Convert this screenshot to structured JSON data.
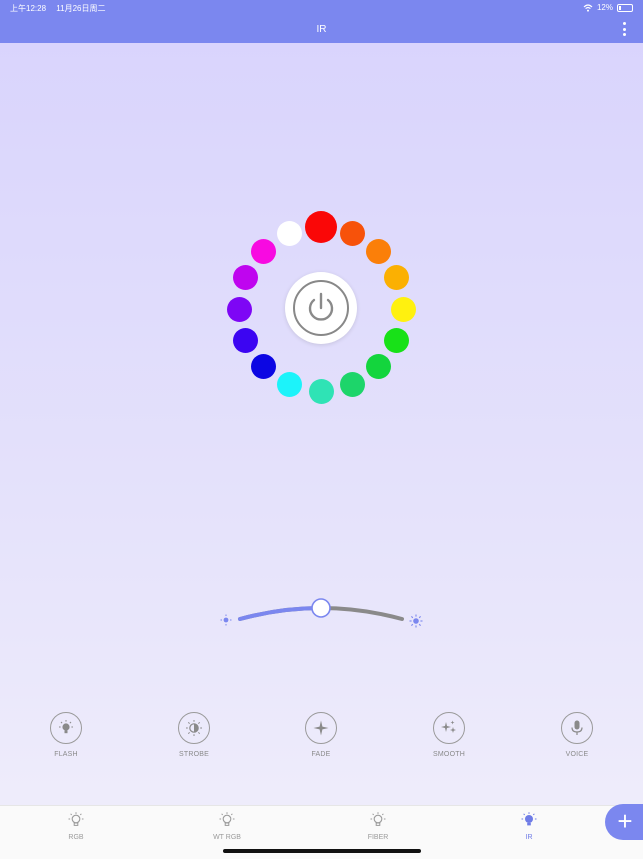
{
  "status_bar": {
    "time": "上午12:28",
    "date": "11月26日周二",
    "battery": "12%"
  },
  "header": {
    "title": "IR"
  },
  "palette": {
    "colors": [
      "#fa0707",
      "#f7520a",
      "#fb7f09",
      "#fbb002",
      "#fff10f",
      "#18e118",
      "#13d53d",
      "#1dd56a",
      "#2fe3b5",
      "#1cf3fa",
      "#0c06e3",
      "#3c05f2",
      "#7e06f5",
      "#bf05ef",
      "#f80ae1",
      "#ffffff"
    ]
  },
  "brightness": {
    "value": 0.5,
    "active_color": "#7b87ef",
    "inactive_color": "#8a8a8a"
  },
  "modes": [
    {
      "label": "FLASH",
      "icon": "flash-bulb-icon"
    },
    {
      "label": "STROBE",
      "icon": "strobe-icon"
    },
    {
      "label": "FADE",
      "icon": "fade-sparkle-icon"
    },
    {
      "label": "SMOOTH",
      "icon": "smooth-sparkles-icon"
    },
    {
      "label": "VOICE",
      "icon": "microphone-icon"
    }
  ],
  "tabs": [
    {
      "label": "RGB",
      "icon": "bulb-icon"
    },
    {
      "label": "WT RGB",
      "icon": "bulb-icon"
    },
    {
      "label": "FIBER",
      "icon": "bulb-icon"
    },
    {
      "label": "IR",
      "icon": "bulb-filled-icon",
      "active": true
    }
  ],
  "fab": {
    "label": "+"
  },
  "theme": {
    "accent": "#7b87ef"
  }
}
